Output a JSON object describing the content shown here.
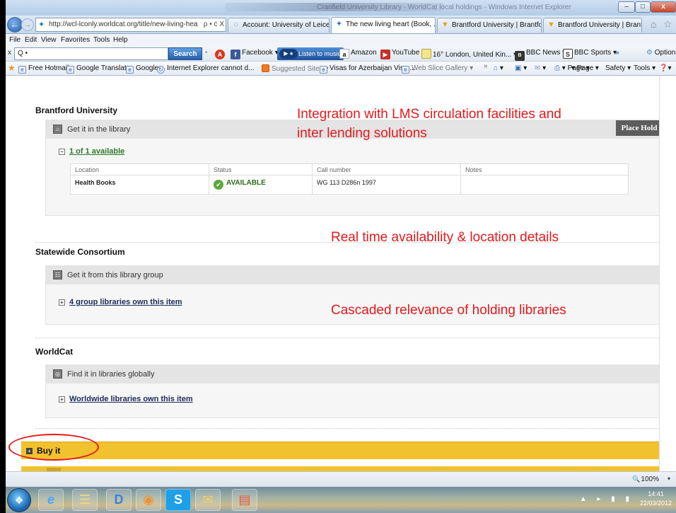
{
  "window": {
    "title": "Cranfield University Library - WorldCat local holdings - Windows Internet Explorer",
    "minimize": "–",
    "maximize": "□",
    "close": "x"
  },
  "nav": {
    "address": "http://wcl-lconly.worldcat.org/title/new-living-hea",
    "address_tools": "ρ • ċ X",
    "tabs": [
      {
        "label": "Account: University of Leiceste...",
        "icon": "circle-icon"
      },
      {
        "label": "The new living heart (Book, ... ×",
        "icon": "worldcat-icon"
      },
      {
        "label": "Brantford University | Brantfor...",
        "icon": "shield-icon"
      },
      {
        "label": "Brantford University | Brantfor...",
        "icon": "shield-icon"
      }
    ]
  },
  "menu": [
    "File",
    "Edit",
    "View",
    "Favorites",
    "Tools",
    "Help"
  ],
  "toolbar": {
    "search_placeholder": "Q •",
    "search_button": "Search",
    "items": [
      "Facebook ▾",
      "Listen to music",
      "Amazon",
      "YouTube",
      "16° London, United Kin... ▾",
      "BBC News ▾",
      "BBC Sports ▾",
      "»"
    ],
    "options": "Options ▾"
  },
  "favorites": {
    "items": [
      "Free Hotmail",
      "Google Translate",
      "Google",
      "Internet Explorer cannot d...",
      "Suggested Sites ▾",
      "Visas for Azerbaijan Visa ...",
      "Web Slice Gallery ▾"
    ],
    "commands": [
      "▾",
      "▾",
      "▾",
      "▾ Page ▾",
      "Safety ▾",
      "Tools ▾",
      "▾"
    ]
  },
  "sections": {
    "brantford": {
      "title": "Brantford University",
      "panel_label": "Get it in the library",
      "availability_link": "1 of 1 available",
      "place_hold": "Place Hold",
      "table": {
        "headers": [
          "Location",
          "Status",
          "Call number",
          "Notes"
        ],
        "row": {
          "location": "Health Books",
          "status": "AVAILABLE",
          "call_number": "WG 113 D286n 1997",
          "notes": ""
        }
      }
    },
    "statewide": {
      "title": "Statewide Consortium",
      "panel_label": "Get it from this library group",
      "link": "4 group libraries own this item"
    },
    "worldcat": {
      "title": "WorldCat",
      "panel_label": "Find it in libraries globally",
      "link": "Worldwide libraries own this item"
    }
  },
  "annotations": {
    "lms_line1": "Integration with  LMS circulation facilities and",
    "lms_line2": "inter lending solutions",
    "realtime": "Real time availability & location details",
    "cascaded": "Cascaded relevance of holding libraries"
  },
  "buy": {
    "label": "Buy it"
  },
  "status": {
    "zoom": "100%",
    "zoom_arrow": "▾"
  },
  "taskbar": {
    "start": "❖",
    "apps": [
      "e",
      "☰",
      "D",
      "◉",
      "S",
      "✉",
      "▤"
    ],
    "tray": "▲ ▸ ▮ ▮",
    "time": "14:41",
    "date": "22/03/2012"
  },
  "colors": {
    "annotation": "#e3191c",
    "buy_bar": "#f2c12e"
  }
}
